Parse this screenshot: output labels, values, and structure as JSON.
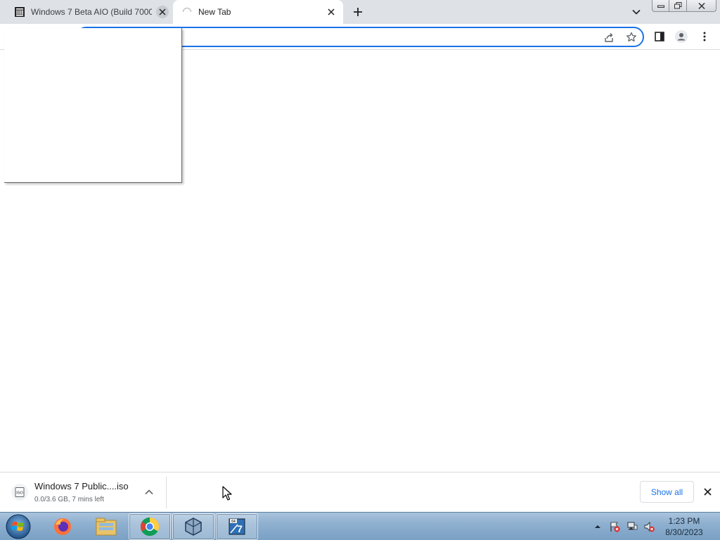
{
  "browser": {
    "tabs": [
      {
        "title": "Windows 7 Beta AIO (Build 7000",
        "favicon": "archive-org-icon"
      },
      {
        "title": "New Tab",
        "favicon": "loading-spinner-icon"
      }
    ],
    "omnibox": {
      "value": "",
      "placeholder": ""
    },
    "accent_color": "#1a73e8"
  },
  "download_shelf": {
    "item": {
      "name": "Windows 7 Public....iso",
      "status": "0.0/3.6 GB, 7 mins left",
      "icon": "iso-file-icon"
    },
    "show_all_label": "Show all"
  },
  "taskbar": {
    "apps": [
      "firefox-icon",
      "windows-explorer-icon",
      "chrome-icon",
      "virtualbox-icon",
      "windows7-iso-icon"
    ],
    "clock": {
      "time": "1:23 PM",
      "date": "8/30/2023"
    }
  }
}
